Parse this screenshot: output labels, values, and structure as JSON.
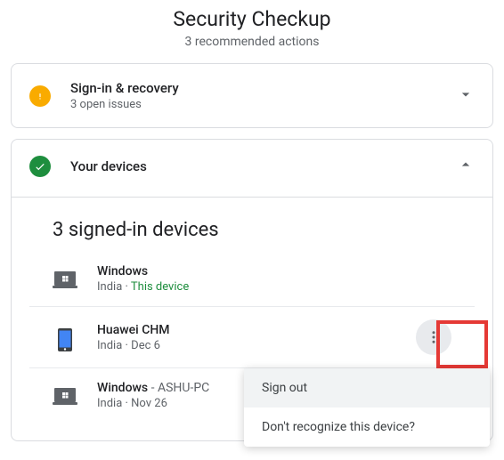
{
  "header": {
    "title": "Security Checkup",
    "subtitle": "3 recommended actions"
  },
  "cards": {
    "signin": {
      "title": "Sign-in & recovery",
      "sub": "3 open issues"
    },
    "devices": {
      "title": "Your devices",
      "section": "3 signed-in devices"
    }
  },
  "devices": [
    {
      "name": "Windows",
      "suffix": "",
      "location": "India",
      "when": "This device",
      "this": true
    },
    {
      "name": "Huawei CHM",
      "suffix": "",
      "location": "India",
      "when": "Dec 6",
      "this": false
    },
    {
      "name": "Windows",
      "suffix": " - ASHU-PC",
      "location": "India",
      "when": "Nov 26",
      "this": false
    }
  ],
  "popup": {
    "signout": "Sign out",
    "unknown": "Don't recognize this device?"
  }
}
